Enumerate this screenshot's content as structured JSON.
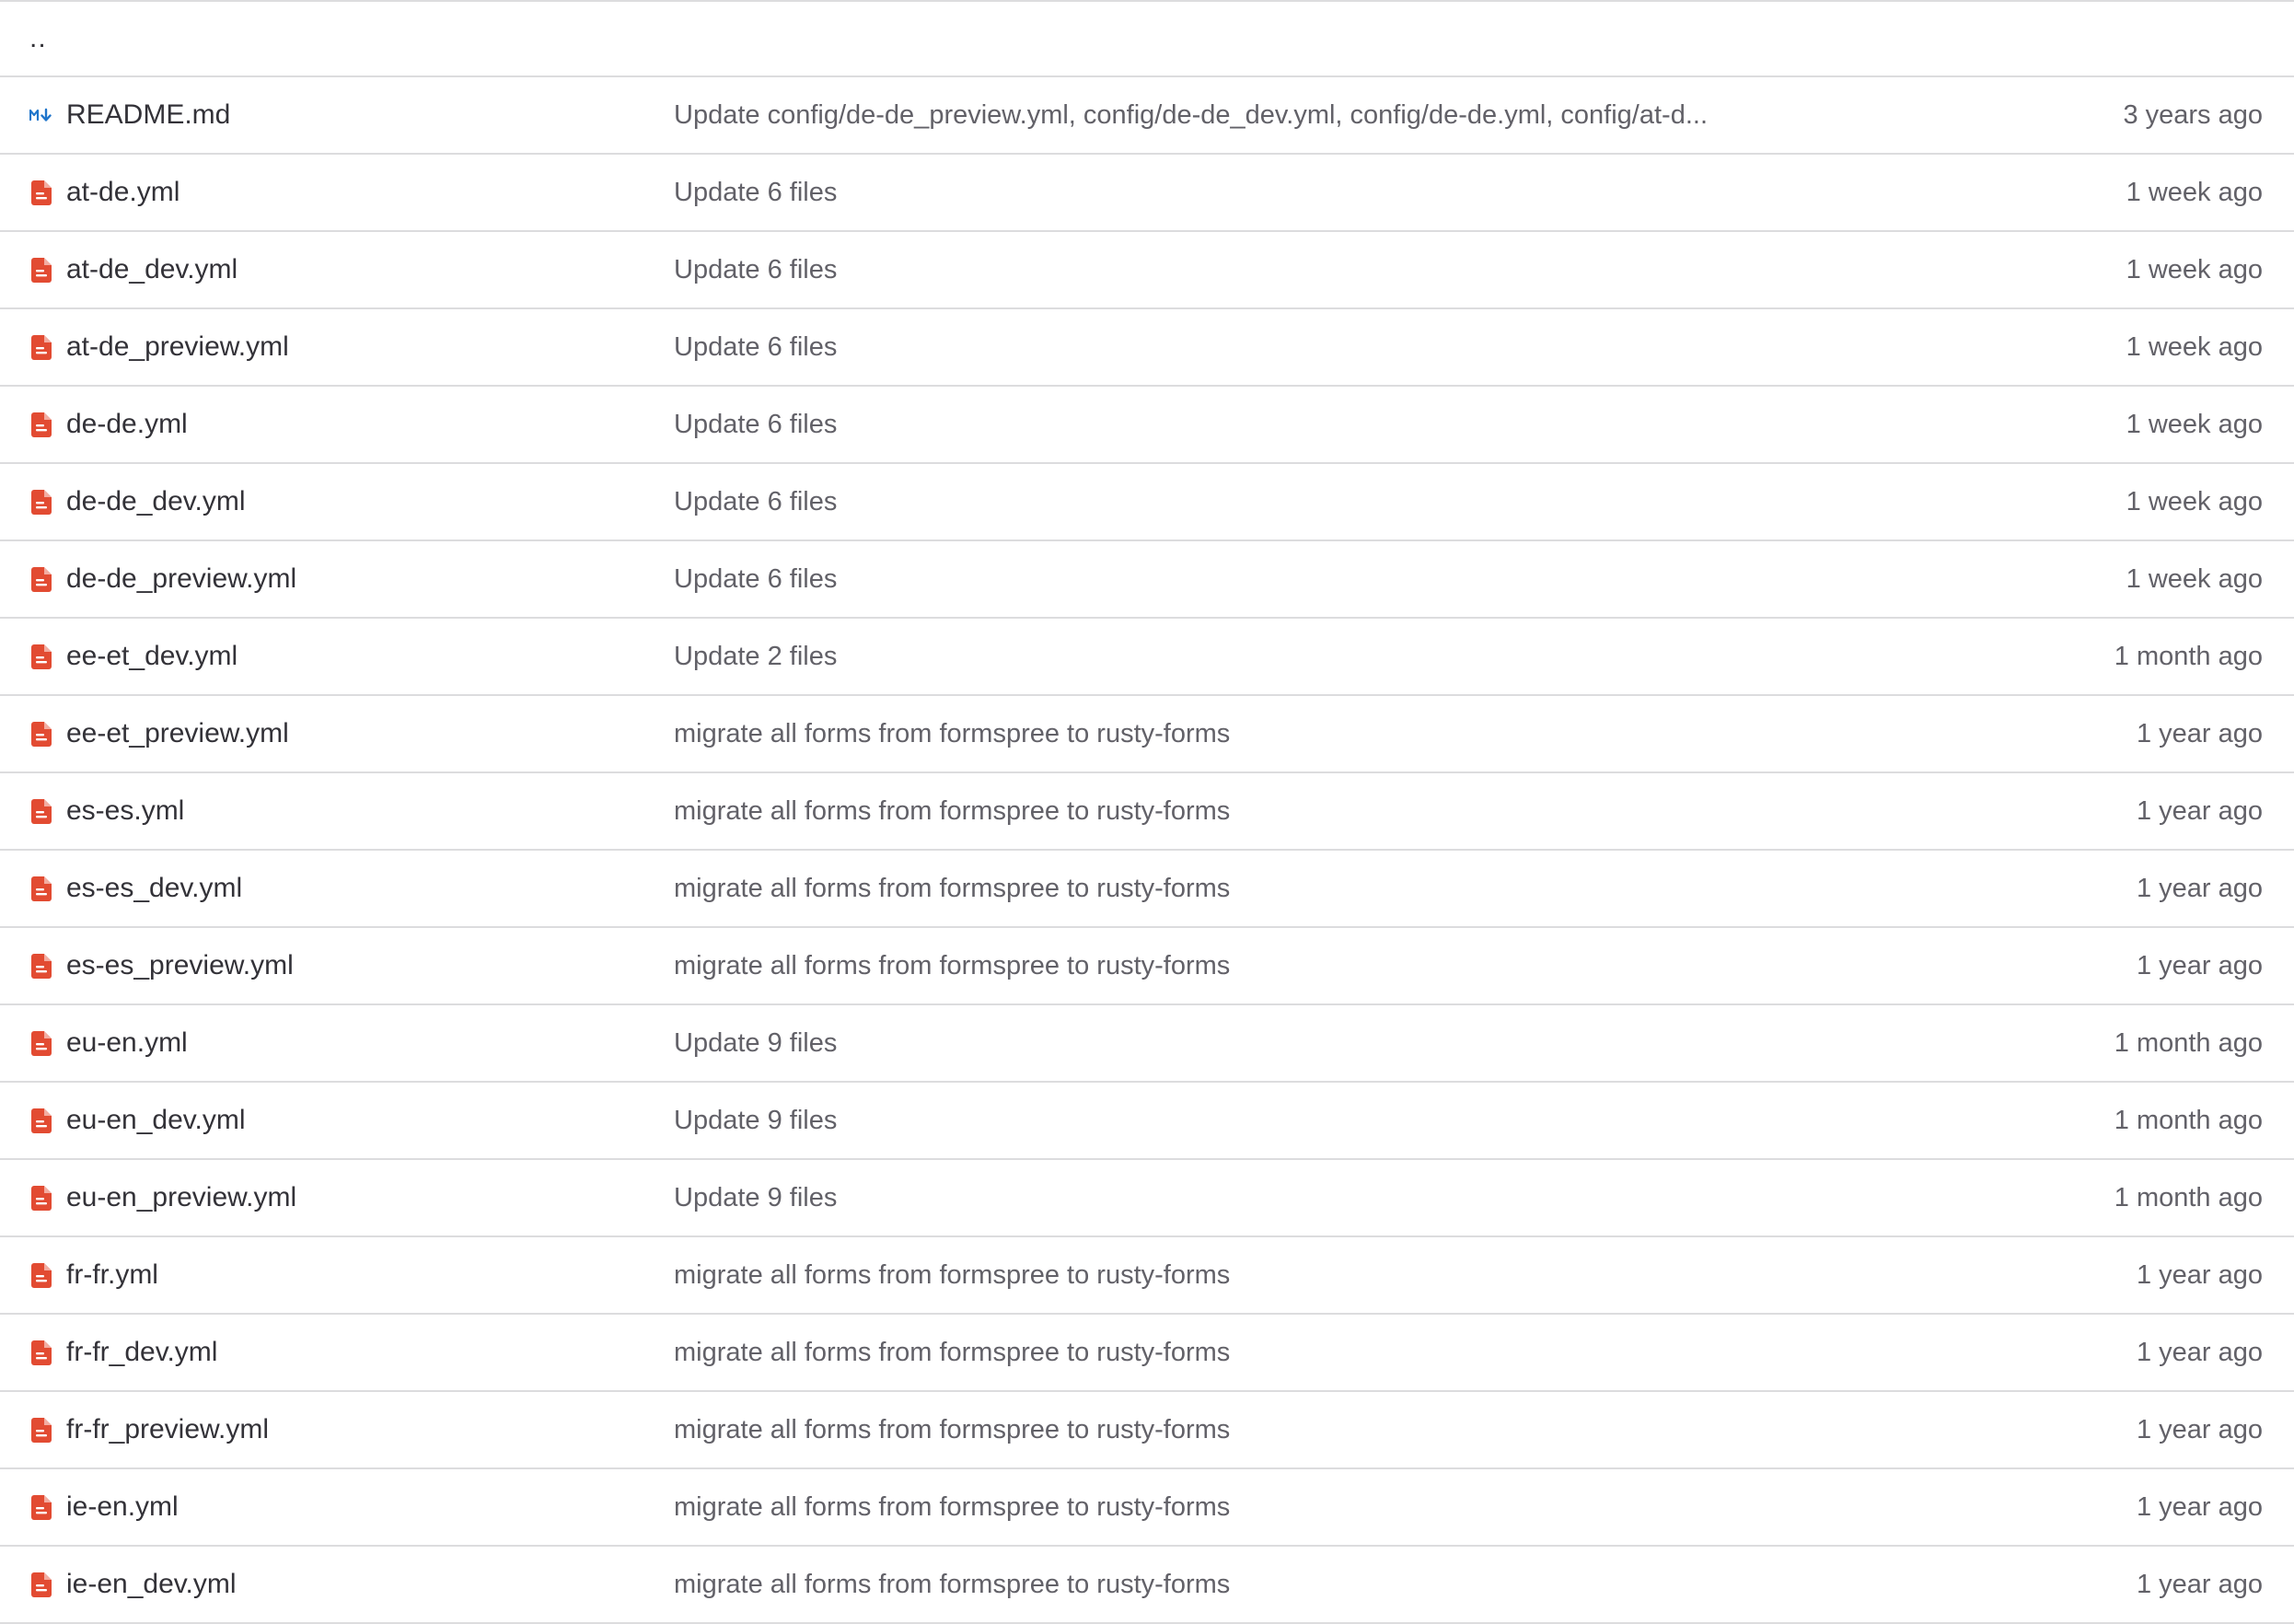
{
  "parent_dir": {
    "label": ".."
  },
  "icons": {
    "markdown": "markdown-icon",
    "yaml": "yaml-file-icon",
    "markdown_color": "#1f75cb",
    "yaml_color": "#dd2b0e"
  },
  "files": [
    {
      "name": "README.md",
      "icon": "markdown",
      "commit": "Update config/de-de_preview.yml, config/de-de_dev.yml, config/de-de.yml, config/at-d...",
      "date": "3 years ago"
    },
    {
      "name": "at-de.yml",
      "icon": "yaml",
      "commit": "Update 6 files",
      "date": "1 week ago"
    },
    {
      "name": "at-de_dev.yml",
      "icon": "yaml",
      "commit": "Update 6 files",
      "date": "1 week ago"
    },
    {
      "name": "at-de_preview.yml",
      "icon": "yaml",
      "commit": "Update 6 files",
      "date": "1 week ago"
    },
    {
      "name": "de-de.yml",
      "icon": "yaml",
      "commit": "Update 6 files",
      "date": "1 week ago"
    },
    {
      "name": "de-de_dev.yml",
      "icon": "yaml",
      "commit": "Update 6 files",
      "date": "1 week ago"
    },
    {
      "name": "de-de_preview.yml",
      "icon": "yaml",
      "commit": "Update 6 files",
      "date": "1 week ago"
    },
    {
      "name": "ee-et_dev.yml",
      "icon": "yaml",
      "commit": "Update 2 files",
      "date": "1 month ago"
    },
    {
      "name": "ee-et_preview.yml",
      "icon": "yaml",
      "commit": "migrate all forms from formspree to rusty-forms",
      "date": "1 year ago"
    },
    {
      "name": "es-es.yml",
      "icon": "yaml",
      "commit": "migrate all forms from formspree to rusty-forms",
      "date": "1 year ago"
    },
    {
      "name": "es-es_dev.yml",
      "icon": "yaml",
      "commit": "migrate all forms from formspree to rusty-forms",
      "date": "1 year ago"
    },
    {
      "name": "es-es_preview.yml",
      "icon": "yaml",
      "commit": "migrate all forms from formspree to rusty-forms",
      "date": "1 year ago"
    },
    {
      "name": "eu-en.yml",
      "icon": "yaml",
      "commit": "Update 9 files",
      "date": "1 month ago"
    },
    {
      "name": "eu-en_dev.yml",
      "icon": "yaml",
      "commit": "Update 9 files",
      "date": "1 month ago"
    },
    {
      "name": "eu-en_preview.yml",
      "icon": "yaml",
      "commit": "Update 9 files",
      "date": "1 month ago"
    },
    {
      "name": "fr-fr.yml",
      "icon": "yaml",
      "commit": "migrate all forms from formspree to rusty-forms",
      "date": "1 year ago"
    },
    {
      "name": "fr-fr_dev.yml",
      "icon": "yaml",
      "commit": "migrate all forms from formspree to rusty-forms",
      "date": "1 year ago"
    },
    {
      "name": "fr-fr_preview.yml",
      "icon": "yaml",
      "commit": "migrate all forms from formspree to rusty-forms",
      "date": "1 year ago"
    },
    {
      "name": "ie-en.yml",
      "icon": "yaml",
      "commit": "migrate all forms from formspree to rusty-forms",
      "date": "1 year ago"
    },
    {
      "name": "ie-en_dev.yml",
      "icon": "yaml",
      "commit": "migrate all forms from formspree to rusty-forms",
      "date": "1 year ago"
    }
  ]
}
